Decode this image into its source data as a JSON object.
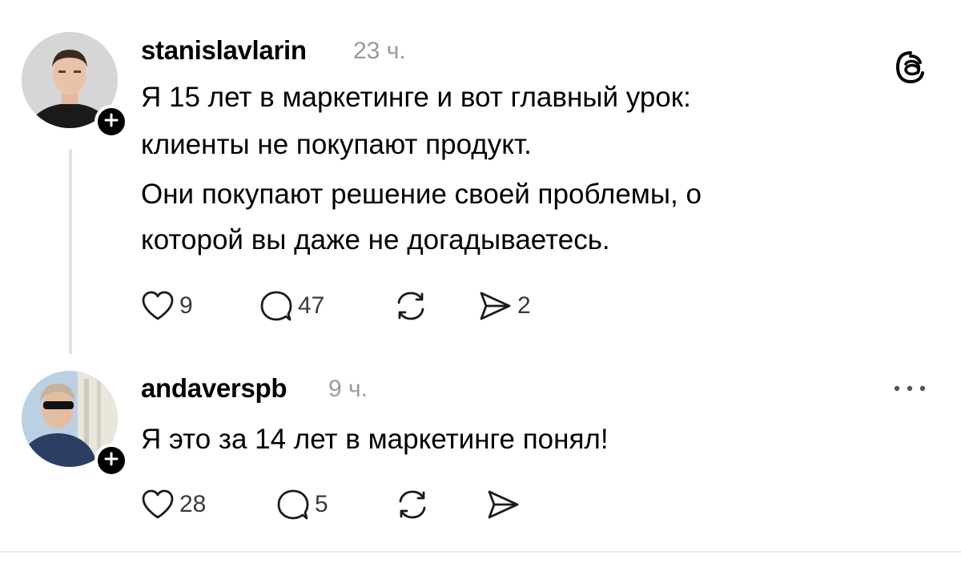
{
  "app": {
    "logo_icon": "threads-logo-icon"
  },
  "posts": [
    {
      "username": "stanislavlarin",
      "time": "23 ч.",
      "lines": [
        "Я 15 лет в маркетинге и вот главный урок:",
        "клиенты не покупают продукт.",
        "Они покупают решение своей проблемы, о",
        "которой вы даже не догадываетесь."
      ],
      "actions": {
        "likes": "9",
        "replies": "47",
        "reposts": "",
        "shares": "2"
      }
    },
    {
      "username": "andaverspb",
      "time": "9 ч.",
      "lines": [
        "Я это за 14 лет в маркетинге понял!"
      ],
      "actions": {
        "likes": "28",
        "replies": "5",
        "reposts": "",
        "shares": ""
      }
    }
  ],
  "colors": {
    "text": "#000000",
    "muted": "#9a9a9a",
    "count": "#3a3a3a",
    "thread_line": "#e2e2e2"
  }
}
